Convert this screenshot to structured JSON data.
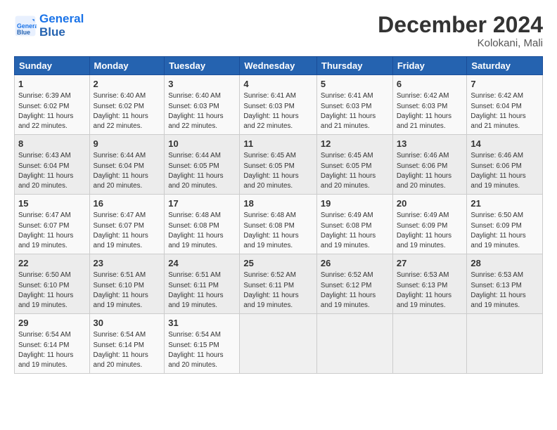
{
  "header": {
    "title": "December 2024",
    "subtitle": "Kolokani, Mali"
  },
  "days": [
    "Sunday",
    "Monday",
    "Tuesday",
    "Wednesday",
    "Thursday",
    "Friday",
    "Saturday"
  ],
  "weeks": [
    [
      {
        "num": "1",
        "info": "Sunrise: 6:39 AM\nSunset: 6:02 PM\nDaylight: 11 hours\nand 22 minutes."
      },
      {
        "num": "2",
        "info": "Sunrise: 6:40 AM\nSunset: 6:02 PM\nDaylight: 11 hours\nand 22 minutes."
      },
      {
        "num": "3",
        "info": "Sunrise: 6:40 AM\nSunset: 6:03 PM\nDaylight: 11 hours\nand 22 minutes."
      },
      {
        "num": "4",
        "info": "Sunrise: 6:41 AM\nSunset: 6:03 PM\nDaylight: 11 hours\nand 22 minutes."
      },
      {
        "num": "5",
        "info": "Sunrise: 6:41 AM\nSunset: 6:03 PM\nDaylight: 11 hours\nand 21 minutes."
      },
      {
        "num": "6",
        "info": "Sunrise: 6:42 AM\nSunset: 6:03 PM\nDaylight: 11 hours\nand 21 minutes."
      },
      {
        "num": "7",
        "info": "Sunrise: 6:42 AM\nSunset: 6:04 PM\nDaylight: 11 hours\nand 21 minutes."
      }
    ],
    [
      {
        "num": "8",
        "info": "Sunrise: 6:43 AM\nSunset: 6:04 PM\nDaylight: 11 hours\nand 20 minutes."
      },
      {
        "num": "9",
        "info": "Sunrise: 6:44 AM\nSunset: 6:04 PM\nDaylight: 11 hours\nand 20 minutes."
      },
      {
        "num": "10",
        "info": "Sunrise: 6:44 AM\nSunset: 6:05 PM\nDaylight: 11 hours\nand 20 minutes."
      },
      {
        "num": "11",
        "info": "Sunrise: 6:45 AM\nSunset: 6:05 PM\nDaylight: 11 hours\nand 20 minutes."
      },
      {
        "num": "12",
        "info": "Sunrise: 6:45 AM\nSunset: 6:05 PM\nDaylight: 11 hours\nand 20 minutes."
      },
      {
        "num": "13",
        "info": "Sunrise: 6:46 AM\nSunset: 6:06 PM\nDaylight: 11 hours\nand 20 minutes."
      },
      {
        "num": "14",
        "info": "Sunrise: 6:46 AM\nSunset: 6:06 PM\nDaylight: 11 hours\nand 19 minutes."
      }
    ],
    [
      {
        "num": "15",
        "info": "Sunrise: 6:47 AM\nSunset: 6:07 PM\nDaylight: 11 hours\nand 19 minutes."
      },
      {
        "num": "16",
        "info": "Sunrise: 6:47 AM\nSunset: 6:07 PM\nDaylight: 11 hours\nand 19 minutes."
      },
      {
        "num": "17",
        "info": "Sunrise: 6:48 AM\nSunset: 6:08 PM\nDaylight: 11 hours\nand 19 minutes."
      },
      {
        "num": "18",
        "info": "Sunrise: 6:48 AM\nSunset: 6:08 PM\nDaylight: 11 hours\nand 19 minutes."
      },
      {
        "num": "19",
        "info": "Sunrise: 6:49 AM\nSunset: 6:08 PM\nDaylight: 11 hours\nand 19 minutes."
      },
      {
        "num": "20",
        "info": "Sunrise: 6:49 AM\nSunset: 6:09 PM\nDaylight: 11 hours\nand 19 minutes."
      },
      {
        "num": "21",
        "info": "Sunrise: 6:50 AM\nSunset: 6:09 PM\nDaylight: 11 hours\nand 19 minutes."
      }
    ],
    [
      {
        "num": "22",
        "info": "Sunrise: 6:50 AM\nSunset: 6:10 PM\nDaylight: 11 hours\nand 19 minutes."
      },
      {
        "num": "23",
        "info": "Sunrise: 6:51 AM\nSunset: 6:10 PM\nDaylight: 11 hours\nand 19 minutes."
      },
      {
        "num": "24",
        "info": "Sunrise: 6:51 AM\nSunset: 6:11 PM\nDaylight: 11 hours\nand 19 minutes."
      },
      {
        "num": "25",
        "info": "Sunrise: 6:52 AM\nSunset: 6:11 PM\nDaylight: 11 hours\nand 19 minutes."
      },
      {
        "num": "26",
        "info": "Sunrise: 6:52 AM\nSunset: 6:12 PM\nDaylight: 11 hours\nand 19 minutes."
      },
      {
        "num": "27",
        "info": "Sunrise: 6:53 AM\nSunset: 6:13 PM\nDaylight: 11 hours\nand 19 minutes."
      },
      {
        "num": "28",
        "info": "Sunrise: 6:53 AM\nSunset: 6:13 PM\nDaylight: 11 hours\nand 19 minutes."
      }
    ],
    [
      {
        "num": "29",
        "info": "Sunrise: 6:54 AM\nSunset: 6:14 PM\nDaylight: 11 hours\nand 19 minutes."
      },
      {
        "num": "30",
        "info": "Sunrise: 6:54 AM\nSunset: 6:14 PM\nDaylight: 11 hours\nand 20 minutes."
      },
      {
        "num": "31",
        "info": "Sunrise: 6:54 AM\nSunset: 6:15 PM\nDaylight: 11 hours\nand 20 minutes."
      },
      null,
      null,
      null,
      null
    ]
  ]
}
